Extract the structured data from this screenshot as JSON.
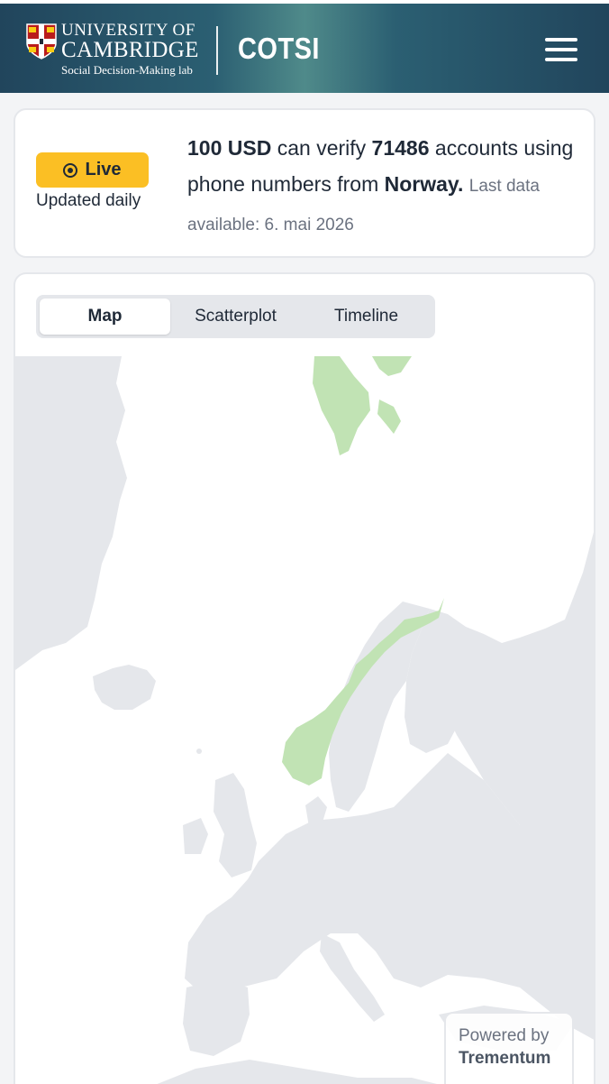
{
  "header": {
    "university_line1": "UNIVERSITY OF",
    "university_line2": "CAMBRIDGE",
    "lab": "Social Decision-Making lab",
    "app_title": "COTSI",
    "menu_icon": "hamburger-menu-icon"
  },
  "summary": {
    "live_label": "Live",
    "live_icon": "radio-dot-icon",
    "updated_label": "Updated daily",
    "amount": "100 USD",
    "text_can_verify": "can verify",
    "accounts_count": "71486",
    "text_accounts": "accounts",
    "text_using": "using phone numbers from",
    "country": "Norway.",
    "last_data": "Last data available: 6. mai 2026"
  },
  "tabs": [
    {
      "label": "Map",
      "active": true
    },
    {
      "label": "Scatterplot",
      "active": false
    },
    {
      "label": "Timeline",
      "active": false
    }
  ],
  "map": {
    "highlighted_country": "Norway",
    "highlight_color": "#c1e3b4",
    "land_color": "#e5e7eb",
    "water_color": "#ffffff"
  },
  "attribution": {
    "powered_by": "Powered by",
    "brand": "Trementum"
  }
}
